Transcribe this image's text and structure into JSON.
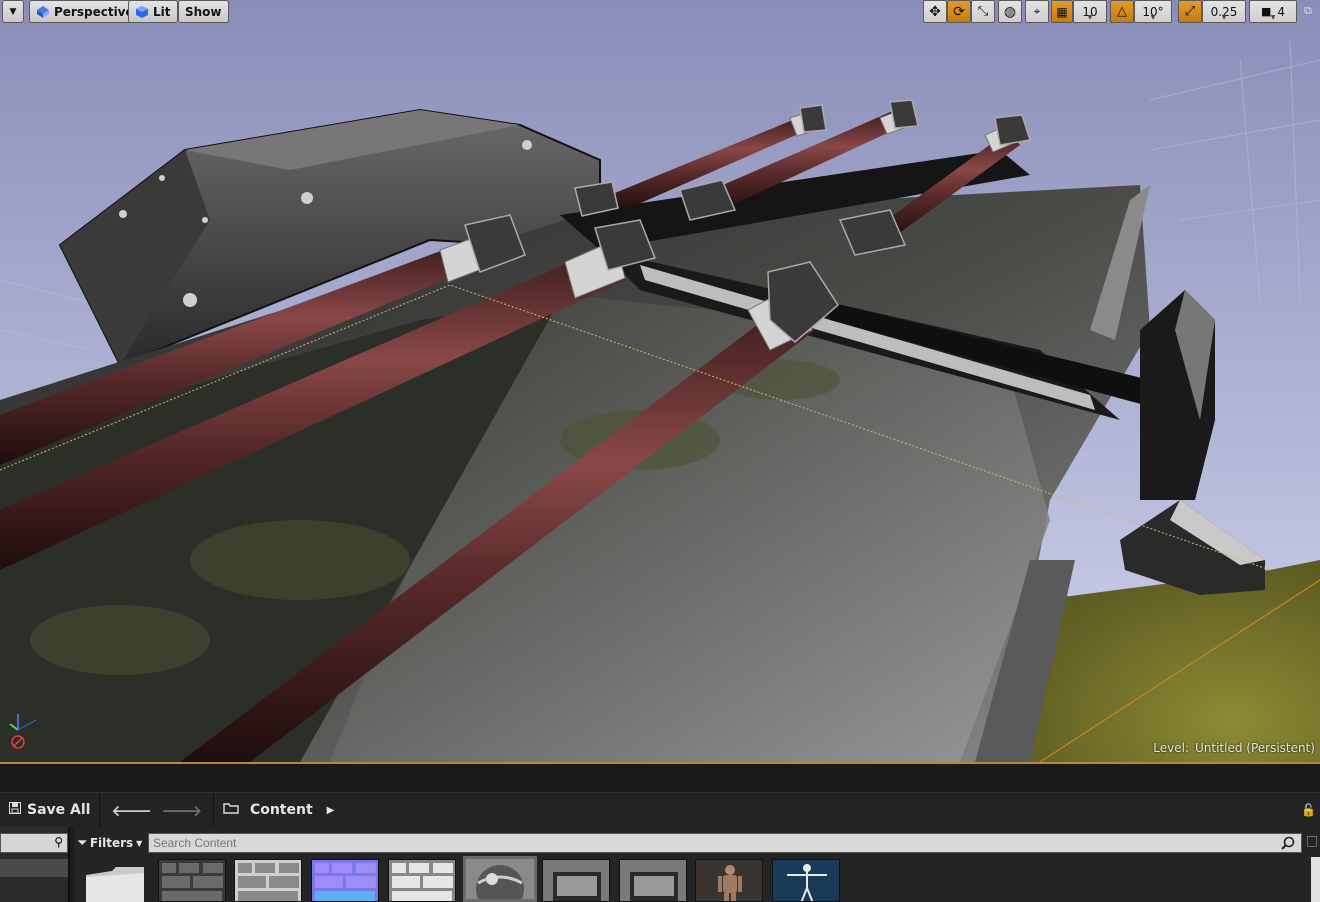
{
  "viewport_toolbar": {
    "perspective_label": "Perspective",
    "lit_label": "Lit",
    "show_label": "Show",
    "grid_snap_value": "10",
    "rotation_snap_value": "10°",
    "scale_snap_value": "0.25",
    "camera_speed_value": "4"
  },
  "viewport": {
    "level_prefix": "Level:",
    "level_name": "Untitled (Persistent)"
  },
  "content_browser": {
    "save_all_label": "Save All",
    "breadcrumb_root": "Content",
    "filters_label": "Filters",
    "search_placeholder": "Search Content",
    "assets": [
      {
        "kind": "folder"
      },
      {
        "kind": "texture-albedo"
      },
      {
        "kind": "texture-light"
      },
      {
        "kind": "texture-normal"
      },
      {
        "kind": "texture-mask"
      },
      {
        "kind": "material-sphere"
      },
      {
        "kind": "static-mesh"
      },
      {
        "kind": "static-mesh"
      },
      {
        "kind": "skeletal-mesh"
      },
      {
        "kind": "skeleton"
      }
    ]
  },
  "colors": {
    "accent_orange": "#d98a1c",
    "sky": "#c9cde8",
    "ground": "#7a7a2a"
  }
}
